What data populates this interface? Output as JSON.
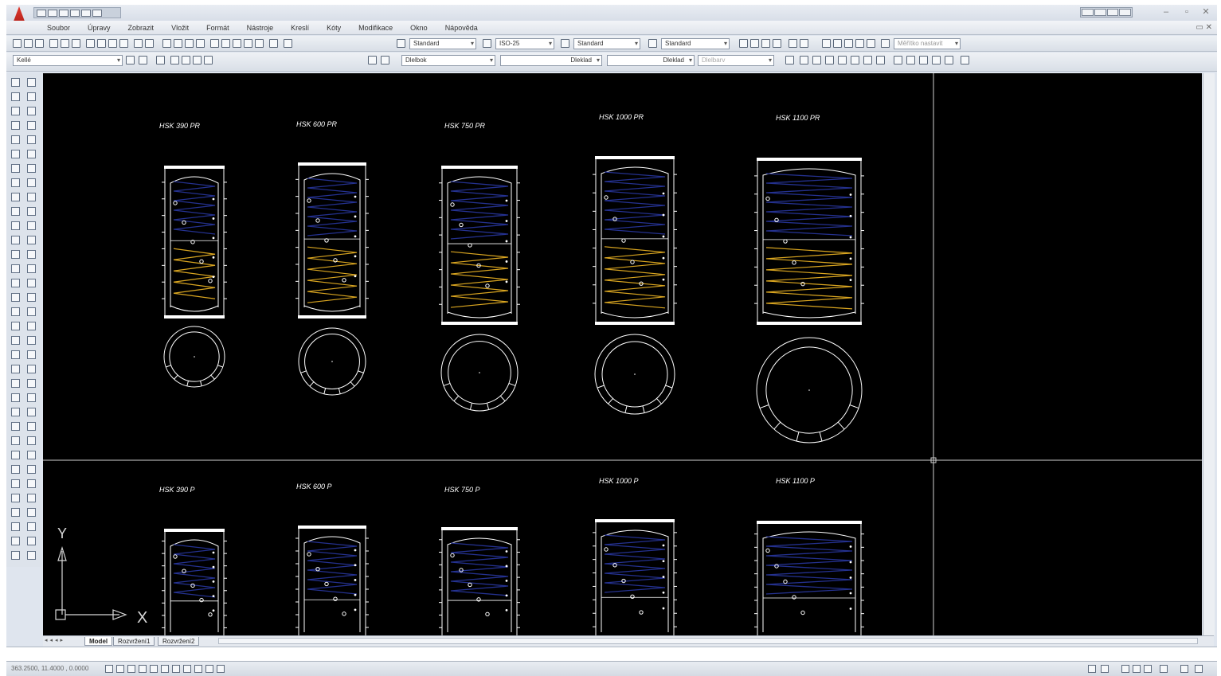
{
  "menubar": {
    "items": [
      "Soubor",
      "Úpravy",
      "Zobrazit",
      "Vložit",
      "Formát",
      "Nástroje",
      "Kreslí",
      "Kóty",
      "Modifikace",
      "Okno",
      "Nápověda"
    ]
  },
  "toolbar1": {
    "text_style": "Standard",
    "dim_style": "ISO-25",
    "table_style": "Standard",
    "multileader_style": "Standard",
    "workspace": "Měřítko nastavit"
  },
  "toolbar2": {
    "layer": "Kellé",
    "color": "Dlelbok",
    "linetype": "Dleklad",
    "lineweight": "Dleklad",
    "plotstyle": "Dlelbarv"
  },
  "drawing": {
    "top_row": [
      {
        "label": "HSK 390 PR"
      },
      {
        "label": "HSK 600 PR"
      },
      {
        "label": "HSK 750 PR"
      },
      {
        "label": "HSK 1000 PR"
      },
      {
        "label": "HSK 1100 PR"
      }
    ],
    "bottom_row": [
      {
        "label": "HSK 390 P"
      },
      {
        "label": "HSK 600 P"
      },
      {
        "label": "HSK 750 P"
      },
      {
        "label": "HSK 1000 P"
      },
      {
        "label": "HSK 1100 P"
      }
    ],
    "ucs": {
      "y_label": "Y",
      "x_label": "X"
    }
  },
  "tabs": {
    "model": "Model",
    "layout1": "Rozvržení1",
    "layout2": "Rozvržení2"
  },
  "status": {
    "coordinates": "363.2500, 11.4000 , 0.0000"
  },
  "colors": {
    "coil_blue": "#24318f",
    "coil_yellow": "#d9a520",
    "line_white": "#ffffff",
    "canvas": "#000000"
  }
}
